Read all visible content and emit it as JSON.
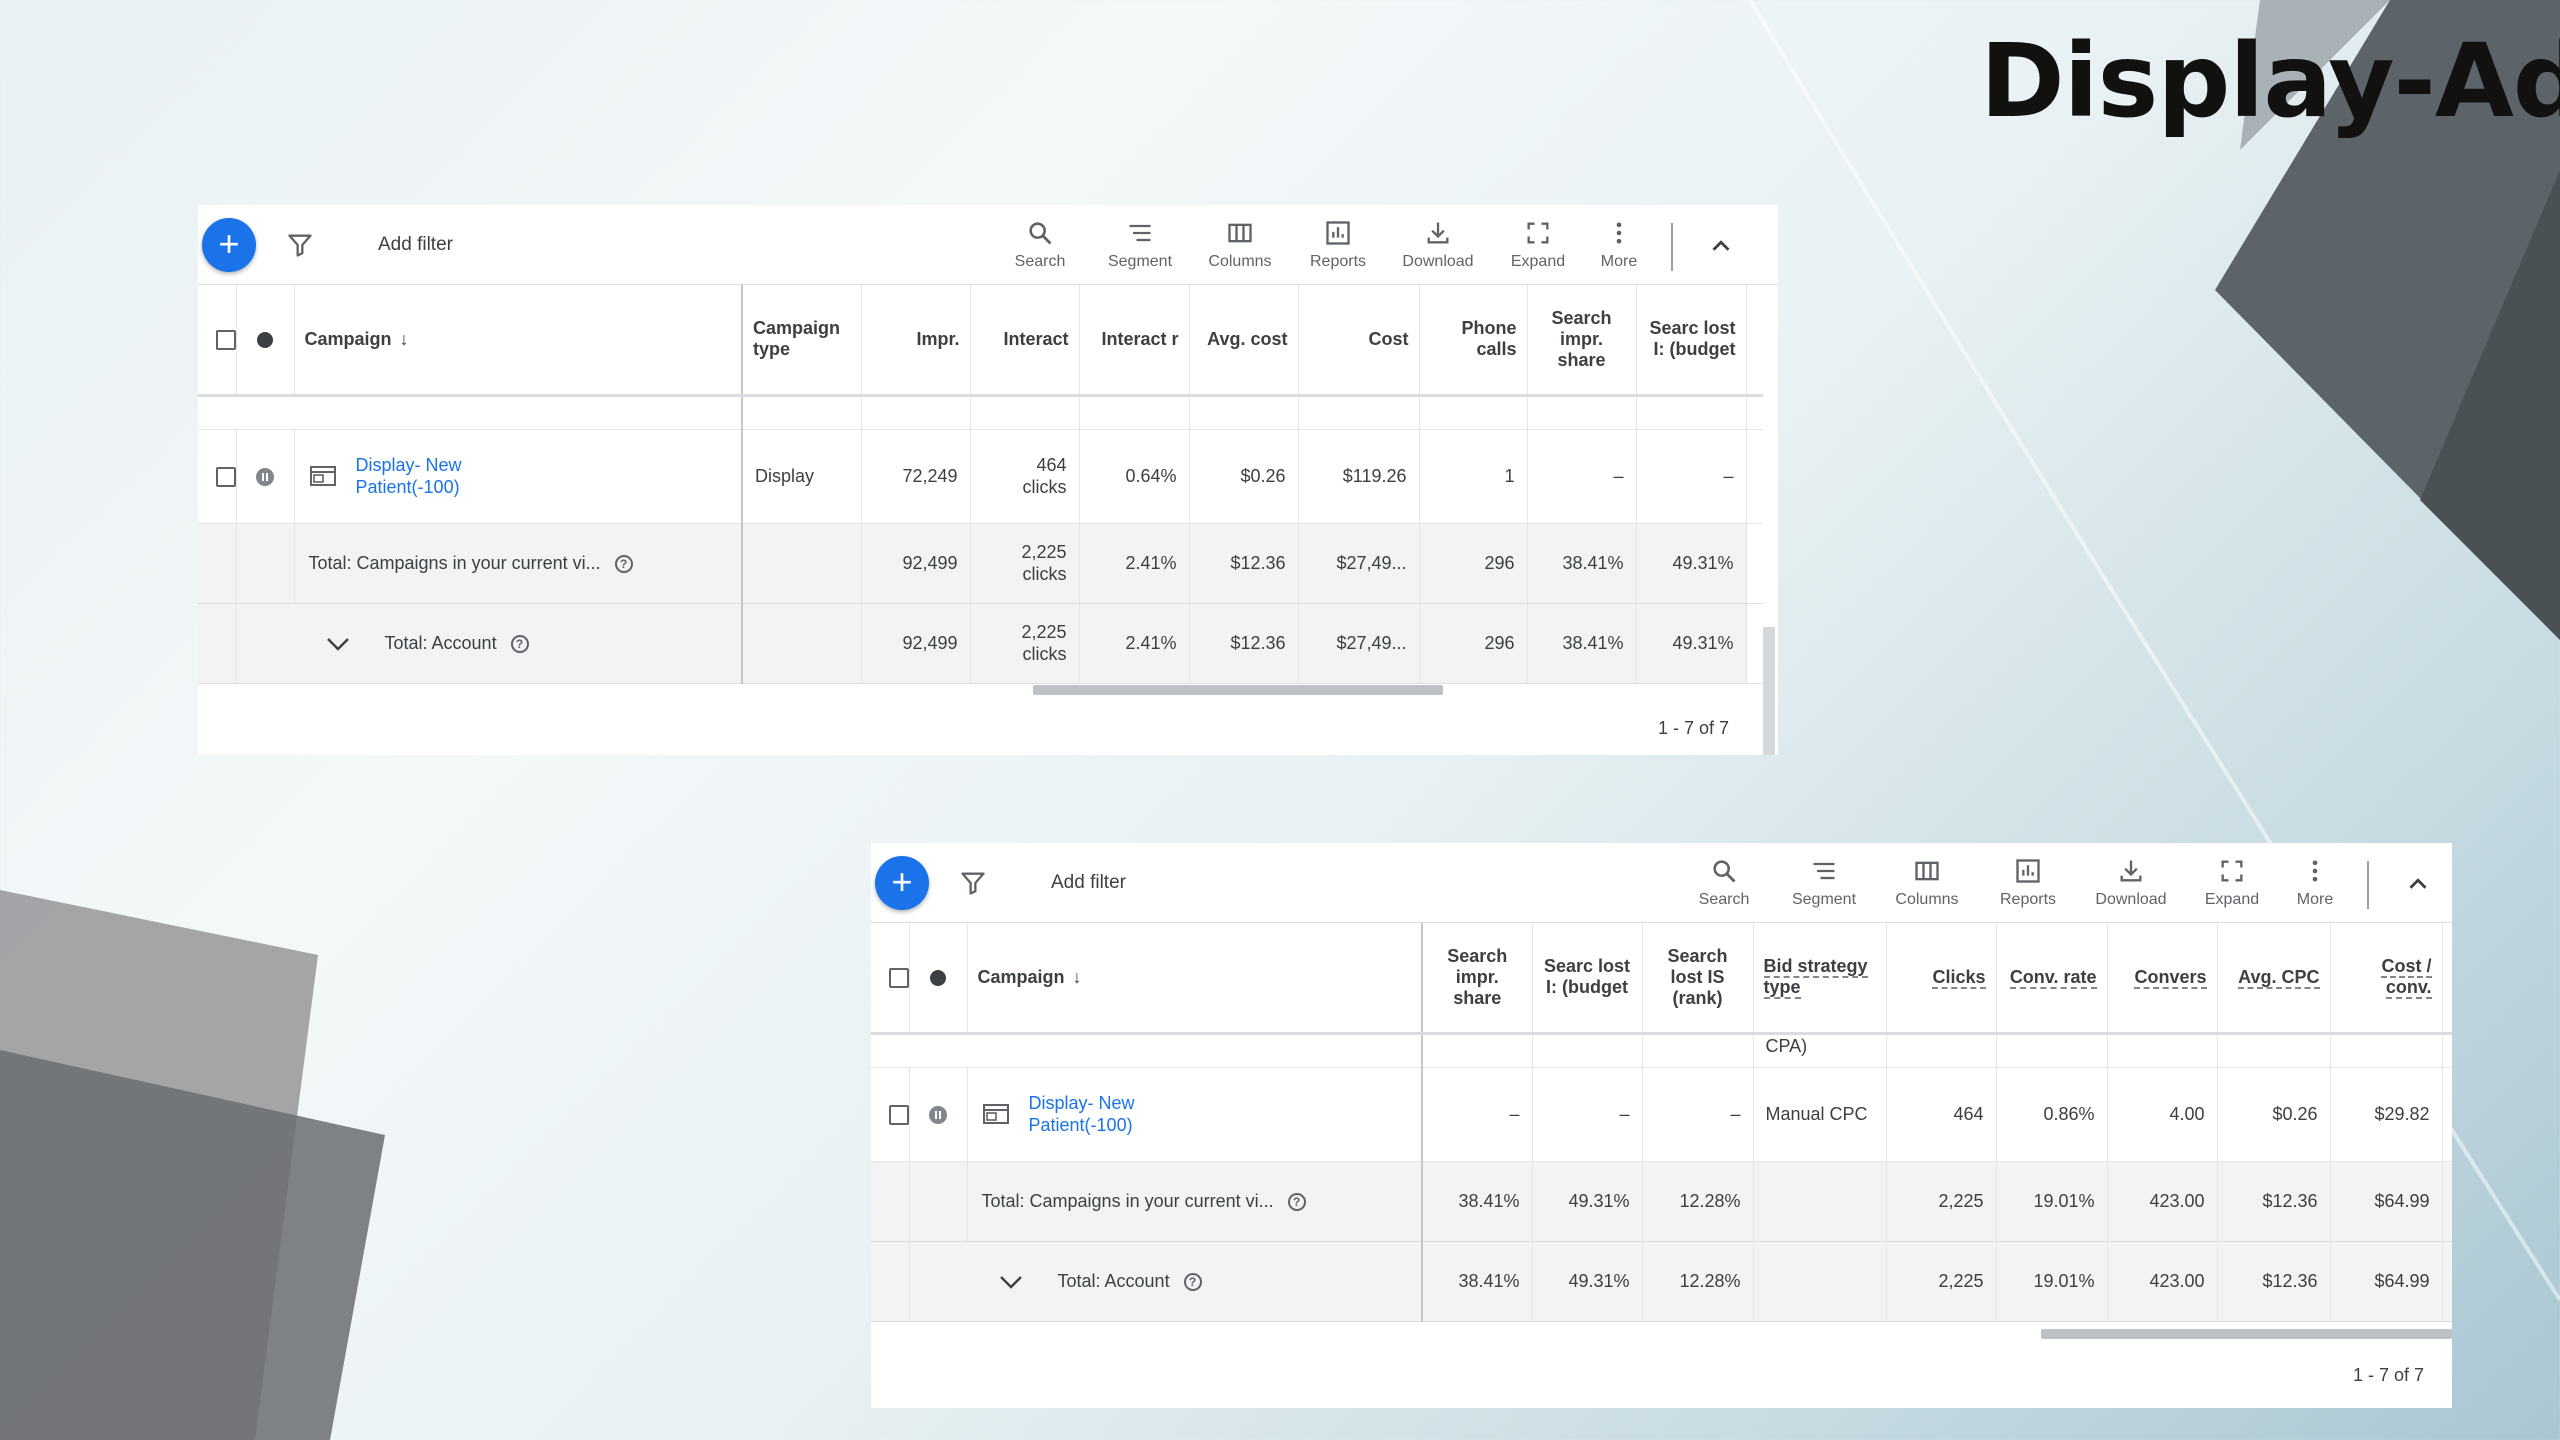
{
  "title": "Display-Ad",
  "toolbar": {
    "add_filter": "Add filter",
    "buttons": [
      "Search",
      "Segment",
      "Columns",
      "Reports",
      "Download",
      "Expand",
      "More"
    ]
  },
  "top_table": {
    "headers": {
      "campaign": "Campaign",
      "campaign_type": "Campaign type",
      "impr": "Impr.",
      "interactions": "Interact",
      "interaction_rate": "Interact r",
      "avg_cost": "Avg. cost",
      "cost": "Cost",
      "phone_calls": "Phone calls",
      "search_impr_share": "Search impr. share",
      "search_lost_is_budget": "Searc lost I: (budget"
    },
    "row": {
      "name": "Display- New Patient(-100)",
      "campaign_type": "Display",
      "impr": "72,249",
      "interactions": "464 clicks",
      "interaction_rate": "0.64%",
      "avg_cost": "$0.26",
      "cost": "$119.26",
      "phone_calls": "1",
      "search_impr_share": "–",
      "search_lost_is_budget": "–"
    },
    "totals": [
      {
        "label": "Total: Campaigns in your current vi...",
        "impr": "92,499",
        "interactions": "2,225 clicks",
        "interaction_rate": "2.41%",
        "avg_cost": "$12.36",
        "cost": "$27,49...",
        "phone_calls": "296",
        "search_impr_share": "38.41%",
        "search_lost_is_budget": "49.31%"
      },
      {
        "label": "Total: Account",
        "impr": "92,499",
        "interactions": "2,225 clicks",
        "interaction_rate": "2.41%",
        "avg_cost": "$12.36",
        "cost": "$27,49...",
        "phone_calls": "296",
        "search_impr_share": "38.41%",
        "search_lost_is_budget": "49.31%"
      }
    ],
    "pagination": "1 - 7 of 7"
  },
  "bottom_table": {
    "headers": {
      "campaign": "Campaign",
      "search_impr_share": "Search impr. share",
      "search_lost_is_budget": "Searc lost I: (budget",
      "search_lost_is_rank": "Search lost IS (rank)",
      "bid_strategy_type": "Bid strategy type",
      "clicks": "Clicks",
      "conv_rate": "Conv. rate",
      "conversions": "Convers",
      "avg_cpc": "Avg. CPC",
      "cost_per_conv": "Cost / conv."
    },
    "clipped_text": "CPA)",
    "row": {
      "name": "Display- New Patient(-100)",
      "search_impr_share": "–",
      "search_lost_is_budget": "–",
      "search_lost_is_rank": "–",
      "bid_strategy_type": "Manual CPC",
      "clicks": "464",
      "conv_rate": "0.86%",
      "conversions": "4.00",
      "avg_cpc": "$0.26",
      "cost_per_conv": "$29.82"
    },
    "totals": [
      {
        "label": "Total: Campaigns in your current vi...",
        "search_impr_share": "38.41%",
        "search_lost_is_budget": "49.31%",
        "search_lost_is_rank": "12.28%",
        "clicks": "2,225",
        "conv_rate": "19.01%",
        "conversions": "423.00",
        "avg_cpc": "$12.36",
        "cost_per_conv": "$64.99"
      },
      {
        "label": "Total: Account",
        "search_impr_share": "38.41%",
        "search_lost_is_budget": "49.31%",
        "search_lost_is_rank": "12.28%",
        "clicks": "2,225",
        "conv_rate": "19.01%",
        "conversions": "423.00",
        "avg_cpc": "$12.36",
        "cost_per_conv": "$64.99"
      }
    ],
    "pagination": "1 - 7 of 7"
  }
}
